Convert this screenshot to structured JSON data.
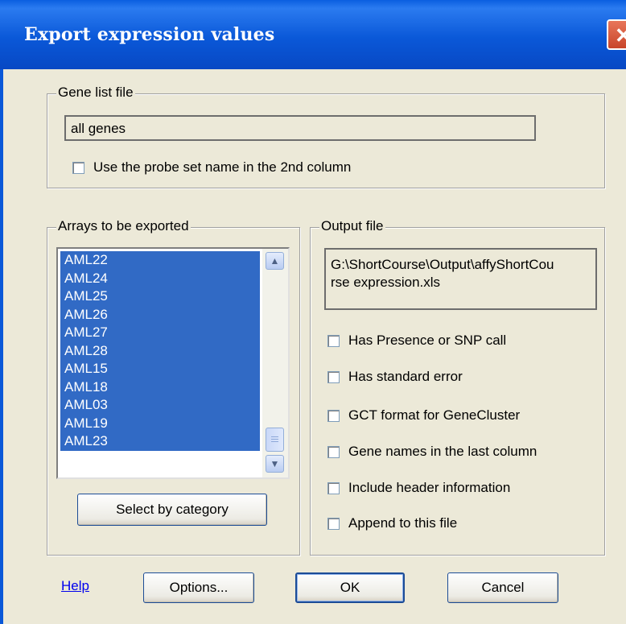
{
  "window": {
    "title": "Export expression values",
    "close_glyph": "✕"
  },
  "gene_list": {
    "legend": "Gene list file",
    "value": "all genes",
    "checkbox_label": "Use the probe set name in the 2nd column",
    "checked": false
  },
  "arrays": {
    "legend": "Arrays to be exported",
    "items": [
      "AML22",
      "AML24",
      "AML25",
      "AML26",
      "AML27",
      "AML28",
      "AML15",
      "AML18",
      "AML03",
      "AML19",
      "AML23"
    ],
    "select_button": "Select by category"
  },
  "output": {
    "legend": "Output file",
    "path_line1": "G:\\ShortCourse\\Output\\affyShortCou",
    "path_line2": "rse expression.xls",
    "options": [
      {
        "label": "Has Presence or SNP call",
        "checked": false
      },
      {
        "label": "Has standard error",
        "checked": false
      },
      {
        "label": "GCT format for GeneCluster",
        "checked": false
      },
      {
        "label": "Gene names in the last column",
        "checked": false
      },
      {
        "label": "Include header information",
        "checked": false
      },
      {
        "label": "Append to this file",
        "checked": false
      }
    ]
  },
  "footer": {
    "help_link": "Help",
    "options_button": "Options...",
    "ok_button": "OK",
    "cancel_button": "Cancel"
  },
  "scrollbar": {
    "up_icon": "▲",
    "down_icon": "▼"
  }
}
